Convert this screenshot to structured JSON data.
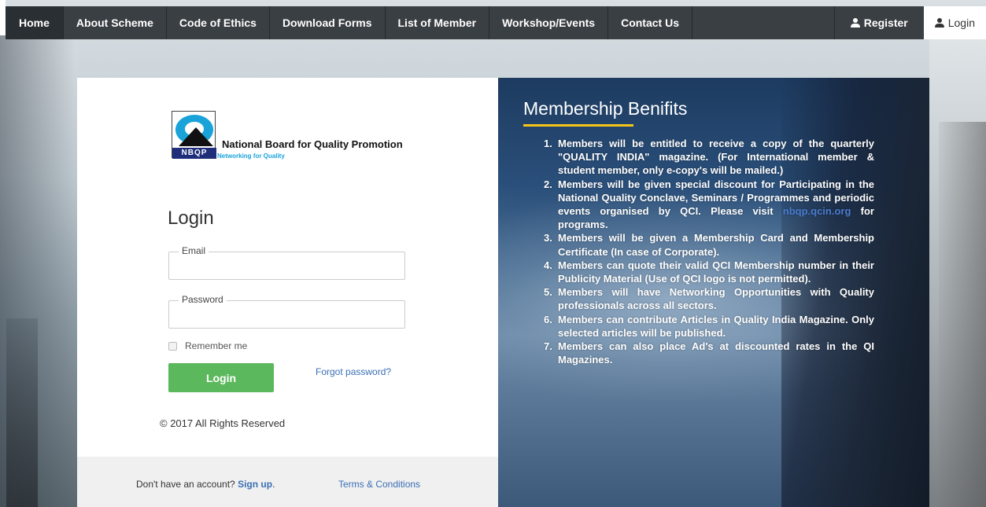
{
  "nav": {
    "items": [
      {
        "label": "Home",
        "name": "nav-home"
      },
      {
        "label": "About Scheme",
        "name": "nav-about-scheme"
      },
      {
        "label": "Code of Ethics",
        "name": "nav-code-of-ethics"
      },
      {
        "label": "Download Forms",
        "name": "nav-download-forms"
      },
      {
        "label": "List of Member",
        "name": "nav-list-of-member"
      },
      {
        "label": "Workshop/Events",
        "name": "nav-workshop-events"
      },
      {
        "label": "Contact Us",
        "name": "nav-contact-us"
      }
    ],
    "register_label": "Register",
    "login_label": "Login"
  },
  "logo": {
    "badge": "NBQP",
    "title": "National Board for Quality Promotion",
    "tagline": "Networking for Quality"
  },
  "login_form": {
    "title": "Login",
    "email_label": "Email",
    "email_value": "",
    "password_label": "Password",
    "password_value": "",
    "remember_label": "Remember me",
    "submit_label": "Login",
    "forgot_label": "Forgot password?",
    "copyright": "© 2017 All Rights Reserved"
  },
  "footer": {
    "signup_prompt": "Don't have an account?",
    "signup_link": "Sign up",
    "signup_suffix": ".",
    "terms_label": "Terms & Conditions"
  },
  "benefits": {
    "title": "Membership Benifits",
    "items": [
      {
        "num": "1.",
        "text": "Members will be entitled to receive a copy of the quarterly \"QUALITY INDIA\" magazine. (For International member & student member, only e-copy's will be mailed.)"
      },
      {
        "num": "2.",
        "text_before": "Members will be given special discount for Participating in the National Quality Conclave, Seminars / Programmes and periodic events organised by QCI. Please visit",
        "link": "nbqp.qcin.org",
        "text_after": "for programs."
      },
      {
        "num": "3.",
        "text": "Members will be given a Membership Card and Membership Certificate (In case of Corporate)."
      },
      {
        "num": "4.",
        "text": "Members can quote their valid QCI Membership number in their Publicity Material (Use of QCI logo is not permitted)."
      },
      {
        "num": "5.",
        "text": "Members will have Networking Opportunities with Quality professionals across all sectors."
      },
      {
        "num": "6.",
        "text": "Members can contribute Articles in Quality India Magazine. Only selected articles will be published."
      },
      {
        "num": "7.",
        "text": "Members can also place Ad's at discounted rates in the QI Magazines."
      }
    ]
  },
  "colors": {
    "nav_bg": "#3a3f44",
    "primary_button": "#5cb85c",
    "link": "#3a6fb5",
    "accent_underline": "#f5c518"
  }
}
